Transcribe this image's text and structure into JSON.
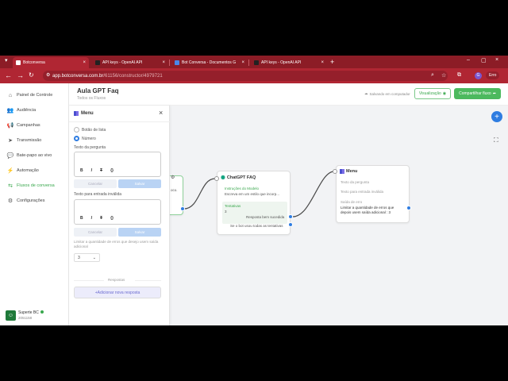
{
  "browser": {
    "tabs": [
      {
        "label": "Botconversa",
        "active": true
      },
      {
        "label": "API keys - OpenAI API",
        "active": false
      },
      {
        "label": "Bot Conversa - Documentos G",
        "active": false
      },
      {
        "label": "API keys - OpenAI API",
        "active": false
      }
    ],
    "url_host": "app.botconversa.com.br",
    "url_path": "/61156/constructor/4979721",
    "profile_initial": "G",
    "error_label": "Erro"
  },
  "sidebar": {
    "items": [
      {
        "label": "Painel de Controle",
        "icon": "home-icon"
      },
      {
        "label": "Audiência",
        "icon": "users-icon"
      },
      {
        "label": "Campanhas",
        "icon": "megaphone-icon"
      },
      {
        "label": "Transmissão",
        "icon": "broadcast-icon"
      },
      {
        "label": "Bate-papo ao vivo",
        "icon": "chat-icon"
      },
      {
        "label": "Automação",
        "icon": "automation-icon"
      },
      {
        "label": "Fluxos de conversa",
        "icon": "flow-icon"
      },
      {
        "label": "Configurações",
        "icon": "gear-icon"
      }
    ],
    "active_index": 6,
    "user": {
      "name": "Superte BC",
      "id": "2051158"
    }
  },
  "header": {
    "title": "Aula GPT Faq",
    "subtitle": "Todos os Fluxos",
    "saved_status": "Salvando em computador",
    "view_button": "Visualização",
    "share_button": "Compartilhar fluxo"
  },
  "panel": {
    "title": "Menu",
    "radio_text": "Botão de lista",
    "radio_number": "Número",
    "question_label": "Texto da pergunta",
    "invalid_label": "Texto para entrada inválida",
    "cancel_label": "Cancelar",
    "save_label": "Salvar",
    "limit_text": "Limitar a quantidade de erros que desejo usem saída adicional",
    "limit_value": "3",
    "responses_label": "Respostas",
    "add_response": "+Adicionar nova resposta"
  },
  "nodes": {
    "partial_text": "oco.",
    "gpt": {
      "title": "ChatGPT FAQ",
      "instr_label": "Instruções do Modelo",
      "instr_text": "Escreva em um estilo que incorp...",
      "tries_label": "Tentativas",
      "tries_value": "3",
      "success": "Resposta bem sucedida",
      "fail": "Se o bot usou todas as tentativas"
    },
    "menu": {
      "title": "Menu",
      "question": "Texto da pergunta",
      "invalid": "Texto para entrada inválida",
      "errors_label": "Saída de erro",
      "limit_line1": "Limitar a quantidade de erros que",
      "limit_line2": "depois usem saída adicional : 3"
    }
  },
  "colors": {
    "browser_chrome": "#b02633",
    "accent_green": "#3aa84e",
    "accent_blue": "#2f7de1"
  }
}
